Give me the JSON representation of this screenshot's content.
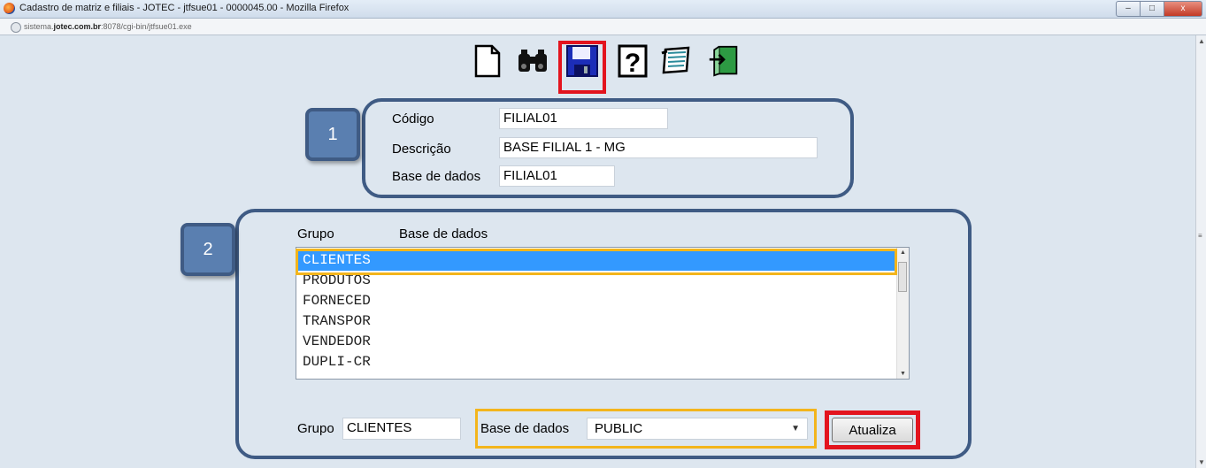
{
  "window": {
    "title": "Cadastro de matriz e filiais - JOTEC - jtfsue01 - 0000045.00 - Mozilla Firefox",
    "url_prefix": "sistema.",
    "url_domain": "jotec.com.br",
    "url_suffix": ":8078/cgi-bin/jtfsue01.exe",
    "controls": [
      "–",
      "□",
      "x"
    ]
  },
  "toolbar": {
    "icons": [
      "new-document-icon",
      "binoculars-search-icon",
      "save-floppy-icon",
      "help-question-icon",
      "notepad-icon",
      "exit-door-icon"
    ]
  },
  "section1": {
    "badge": "1",
    "codigo_label": "Código",
    "codigo_value": "FILIAL01",
    "descricao_label": "Descrição",
    "descricao_value": "BASE FILIAL 1 - MG",
    "base_label": "Base de dados",
    "base_value": "FILIAL01"
  },
  "section2": {
    "badge": "2",
    "col_grupo": "Grupo",
    "col_base": "Base de dados",
    "list": [
      "CLIENTES",
      "PRODUTOS",
      "FORNECED",
      "TRANSPOR",
      "VENDEDOR",
      "DUPLI-CR"
    ],
    "grupo_label": "Grupo",
    "grupo_value": "CLIENTES",
    "base_label": "Base de dados",
    "base_value": "PUBLIC",
    "button": "Atualiza"
  },
  "colors": {
    "panel_border": "#3f5b84",
    "badge_fill": "#5a7fb0",
    "red_highlight": "#e3141e",
    "yellow_highlight": "#f3b51c",
    "selection": "#3399ff"
  }
}
